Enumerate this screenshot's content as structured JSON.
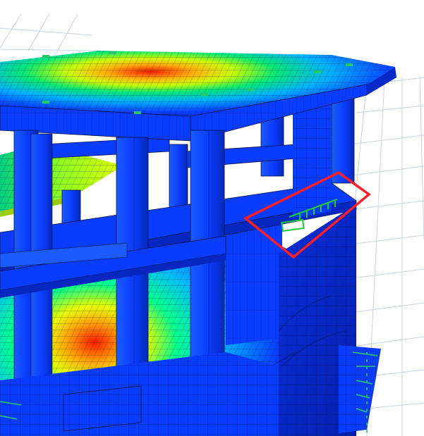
{
  "viewport": {
    "scene": "3d-structural-fem-model",
    "background_color": "#ffffff",
    "grid_color": "#c9d3e3",
    "frame_color": "#0a3cff",
    "frame_shade_color": "#0729c8",
    "edge_color": "#0b1440",
    "contour_colors": [
      "#0000ff",
      "#00c8ff",
      "#00ff80",
      "#c8ff00",
      "#ffb000",
      "#ff2000"
    ],
    "selection_color": "#ff1f2a",
    "support_color": "#26c96a",
    "load_marker_color": "#22c83c"
  }
}
